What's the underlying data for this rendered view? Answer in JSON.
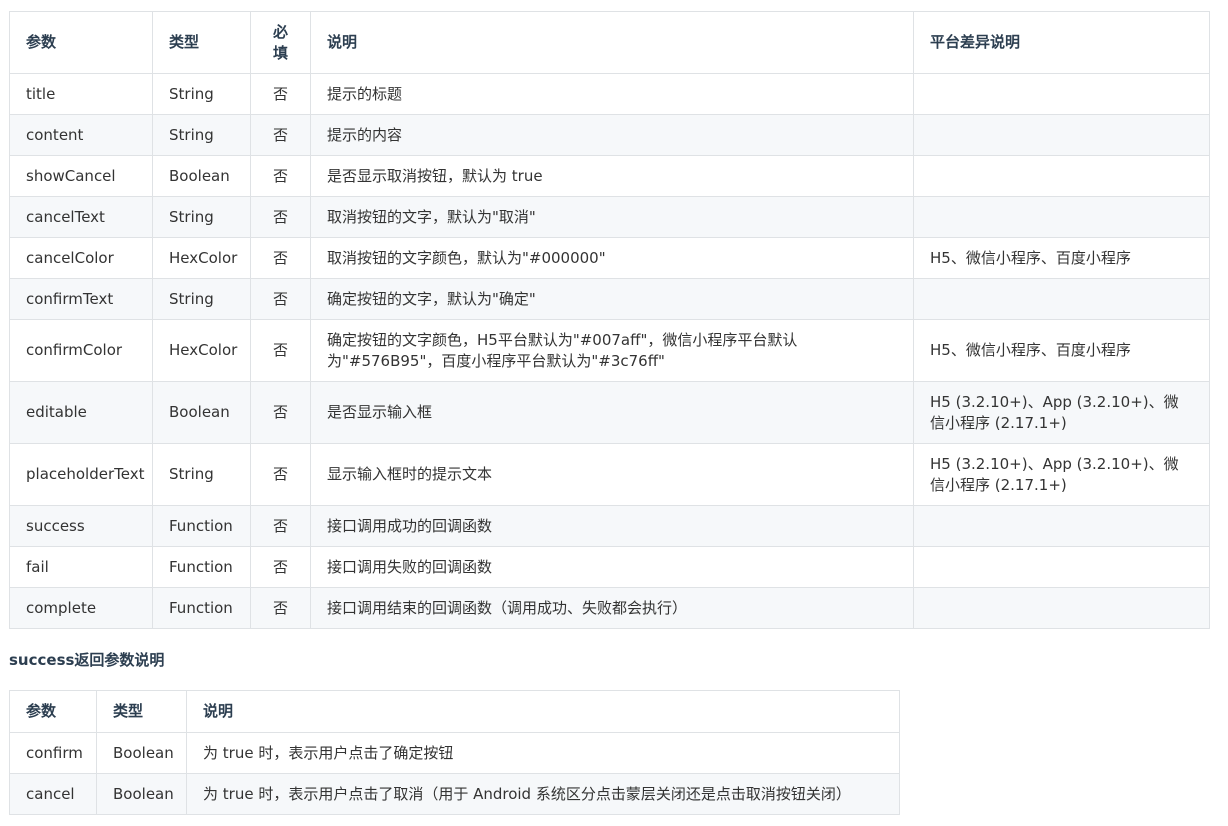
{
  "params_table": {
    "headers": [
      "参数",
      "类型",
      "必\n填",
      "说明",
      "平台差异说明"
    ],
    "rows": [
      {
        "name": "title",
        "type": "String",
        "required": "否",
        "desc": "提示的标题",
        "platform": ""
      },
      {
        "name": "content",
        "type": "String",
        "required": "否",
        "desc": "提示的内容",
        "platform": ""
      },
      {
        "name": "showCancel",
        "type": "Boolean",
        "required": "否",
        "desc": "是否显示取消按钮，默认为 true",
        "platform": ""
      },
      {
        "name": "cancelText",
        "type": "String",
        "required": "否",
        "desc": "取消按钮的文字，默认为\"取消\"",
        "platform": ""
      },
      {
        "name": "cancelColor",
        "type": "HexColor",
        "required": "否",
        "desc": "取消按钮的文字颜色，默认为\"#000000\"",
        "platform": "H5、微信小程序、百度小程序"
      },
      {
        "name": "confirmText",
        "type": "String",
        "required": "否",
        "desc": "确定按钮的文字，默认为\"确定\"",
        "platform": ""
      },
      {
        "name": "confirmColor",
        "type": "HexColor",
        "required": "否",
        "desc": "确定按钮的文字颜色，H5平台默认为\"#007aff\"，微信小程序平台默认为\"#576B95\"，百度小程序平台默认为\"#3c76ff\"",
        "platform": "H5、微信小程序、百度小程序"
      },
      {
        "name": "editable",
        "type": "Boolean",
        "required": "否",
        "desc": "是否显示输入框",
        "platform": "H5 (3.2.10+)、App (3.2.10+)、微信小程序 (2.17.1+)"
      },
      {
        "name": "placeholderText",
        "type": "String",
        "required": "否",
        "desc": "显示输入框时的提示文本",
        "platform": "H5 (3.2.10+)、App (3.2.10+)、微信小程序 (2.17.1+)"
      },
      {
        "name": "success",
        "type": "Function",
        "required": "否",
        "desc": "接口调用成功的回调函数",
        "platform": ""
      },
      {
        "name": "fail",
        "type": "Function",
        "required": "否",
        "desc": "接口调用失败的回调函数",
        "platform": ""
      },
      {
        "name": "complete",
        "type": "Function",
        "required": "否",
        "desc": "接口调用结束的回调函数（调用成功、失败都会执行）",
        "platform": ""
      }
    ]
  },
  "success_heading": "success返回参数说明",
  "success_table": {
    "headers": [
      "参数",
      "类型",
      "说明"
    ],
    "rows": [
      {
        "name": "confirm",
        "type": "Boolean",
        "desc": "为 true 时，表示用户点击了确定按钮"
      },
      {
        "name": "cancel",
        "type": "Boolean",
        "desc": "为 true 时，表示用户点击了取消（用于 Android 系统区分点击蒙层关闭还是点击取消按钮关闭）"
      }
    ]
  }
}
